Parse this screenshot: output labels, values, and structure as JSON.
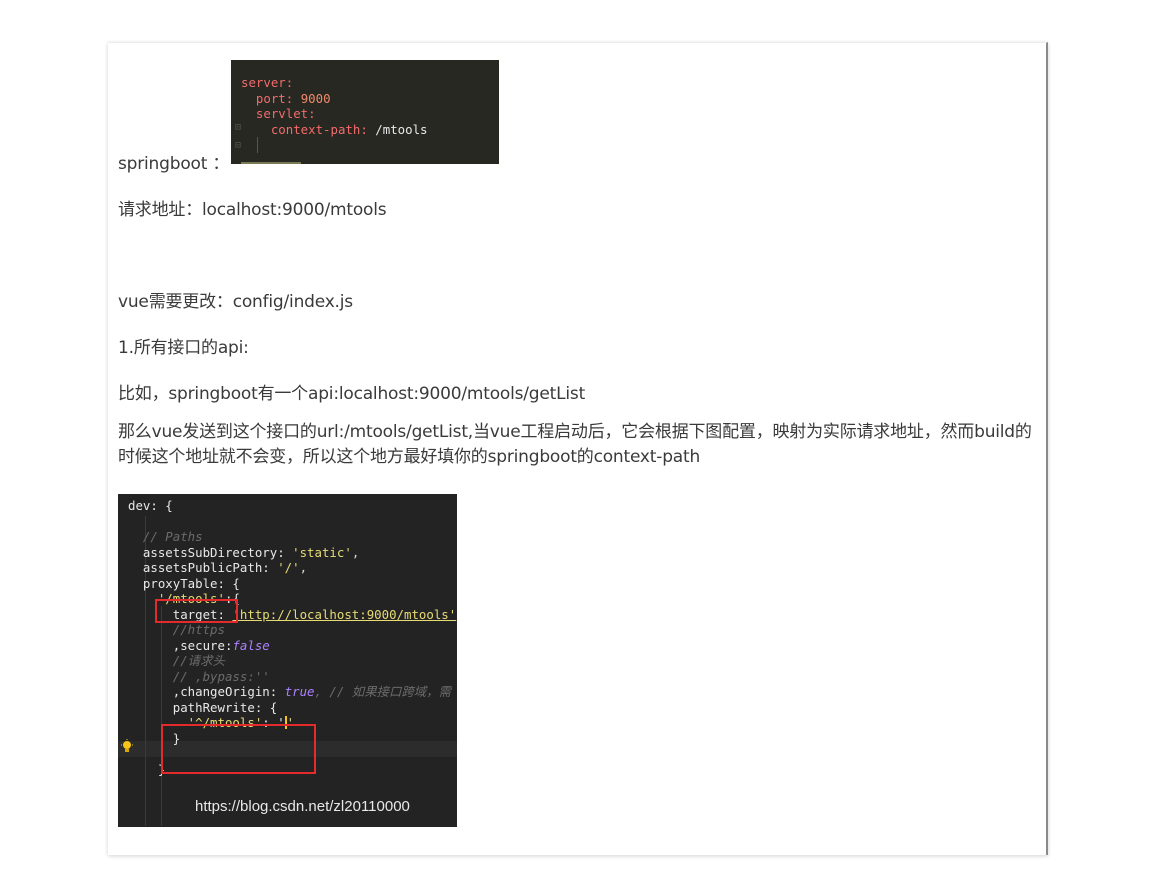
{
  "article": {
    "springboot_label": "springboot ：",
    "request_address": "请求地址：localhost:9000/mtools",
    "vue_change": "vue需要更改：config/index.js",
    "all_api": "1.所有接口的api:",
    "example": "比如，springboot有一个api:localhost:9000/mtools/getList",
    "explain": "那么vue发送到这个接口的url:/mtools/getList,当vue工程启动后，它会根据下图配置，映射为实际请求地址，然而build的时候这个地址就不会变，所以这个地方最好填你的springboot的context-path"
  },
  "yaml_screenshot": {
    "line1": "server:",
    "line2_key": "  port: ",
    "line2_val": "9000",
    "line3": "  servlet:",
    "line4_key": "    context-path: ",
    "line4_val": "/mtools"
  },
  "dev_screenshot": {
    "dev": "dev: {",
    "paths_comment": "  // Paths",
    "assets_sub_key": "  assetsSubDirectory: ",
    "assets_sub_val": "'static'",
    "assets_pub_key": "  assetsPublicPath: ",
    "assets_pub_val": "'/'",
    "proxy_table": "  proxyTable: {",
    "mtools_key": "'/mtools'",
    "mtools_rest": ":{",
    "target_key": "      target: ",
    "target_val": "'http://localhost:9000/mtools'",
    "https_comment": "      //https",
    "secure_key": "      ,secure:",
    "secure_val": "false",
    "header_comment": "      //请求头",
    "bypass_comment": "      // ,bypass:''",
    "change_origin_key": "      ,changeOrigin: ",
    "change_origin_val": "true",
    "change_origin_comment": ", // 如果接口跨域，需",
    "path_rewrite": "      pathRewrite: {",
    "rewrite_key": "        '^/mtools'",
    "rewrite_rest": ": '",
    "rewrite_end": "'",
    "close_inner": "      }",
    "close_outer": "    }",
    "watermark": "https://blog.csdn.net/zl20110000"
  },
  "colors": {
    "code_bg": "#232323",
    "highlight_box": "#e32b2b",
    "text": "#3a3a3a"
  }
}
